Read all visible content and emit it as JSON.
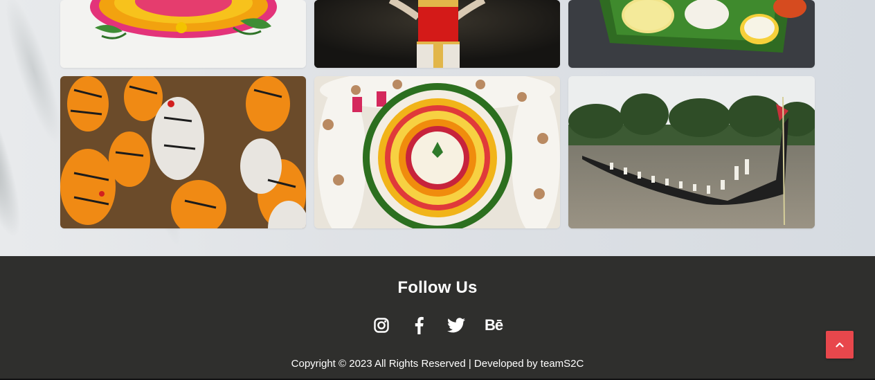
{
  "gallery": {
    "images": [
      {
        "subject": "flower-rangoli-pookalam"
      },
      {
        "subject": "kathakali-dancer"
      },
      {
        "subject": "onam-sadya-on-banana-leaf"
      },
      {
        "subject": "pulikali-tiger-dance"
      },
      {
        "subject": "pookalam-with-women-seated"
      },
      {
        "subject": "snake-boat-race"
      }
    ]
  },
  "footer": {
    "follow_title": "Follow Us",
    "social": [
      {
        "icon": "instagram-icon"
      },
      {
        "icon": "facebook-icon"
      },
      {
        "icon": "twitter-icon"
      },
      {
        "icon": "behance-icon",
        "text": "Bē"
      }
    ],
    "copyright": "Copyright © 2023 All Rights Reserved | Developed by teamS2C"
  },
  "back_to_top": {
    "icon": "chevron-up-icon"
  },
  "colors": {
    "footer_bg": "#2f2f2d",
    "accent": "#e8474c"
  }
}
